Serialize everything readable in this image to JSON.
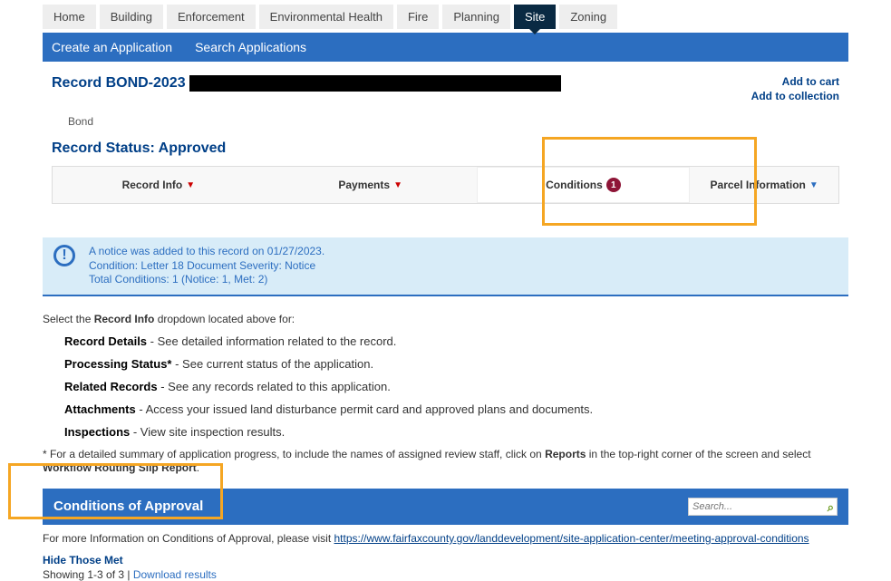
{
  "main_tabs": {
    "items": [
      "Home",
      "Building",
      "Enforcement",
      "Environmental Health",
      "Fire",
      "Planning",
      "Site",
      "Zoning"
    ],
    "active_index": 6
  },
  "sub_bar": {
    "create": "Create an Application",
    "search": "Search Applications"
  },
  "record": {
    "title_prefix": "Record BOND-2023",
    "add_to_cart": "Add to cart",
    "add_to_collection": "Add to collection",
    "bond": "Bond",
    "record_status_label": "Record Status: Approved"
  },
  "detail_tabs": {
    "record_info": "Record Info",
    "payments": "Payments",
    "conditions": "Conditions",
    "conditions_badge": "1",
    "parcel_info": "Parcel Information"
  },
  "notice": {
    "line1": "A notice was added to this record on 01/27/2023.",
    "line2": "Condition: Letter 18 Document   Severity: Notice",
    "line3": "Total Conditions: 1  (Notice: 1, Met: 2)"
  },
  "help": {
    "intro_pre": "Select the ",
    "intro_bold": "Record Info",
    "intro_post": " dropdown located above for:",
    "items": [
      {
        "b": "Record Details",
        "t": " - See detailed information related to the record."
      },
      {
        "b": "Processing Status*",
        "t": " - See current status of the application."
      },
      {
        "b": "Related Records",
        "t": " - See any records related to this application."
      },
      {
        "b": "Attachments",
        "t": " - Access your issued land disturbance permit card and approved plans and documents."
      },
      {
        "b": "Inspections",
        "t": " - View site inspection results."
      }
    ],
    "reports_pre": "* For a detailed summary of application progress, to include the names of assigned review staff, click on ",
    "reports_b1": "Reports",
    "reports_mid": " in the top-right corner of the screen and select ",
    "reports_b2": "Workflow Routing Slip Report",
    "reports_post": "."
  },
  "coa": {
    "header": "Conditions of Approval",
    "search_placeholder": "Search...",
    "info_pre": "For more Information on Conditions of Approval, please visit ",
    "info_link": "https://www.fairfaxcounty.gov/landdevelopment/site-application-center/meeting-approval-conditions",
    "hide_met": "Hide Those Met",
    "showing_pre": "Showing 1-3 of 3 | ",
    "download": "Download results"
  }
}
